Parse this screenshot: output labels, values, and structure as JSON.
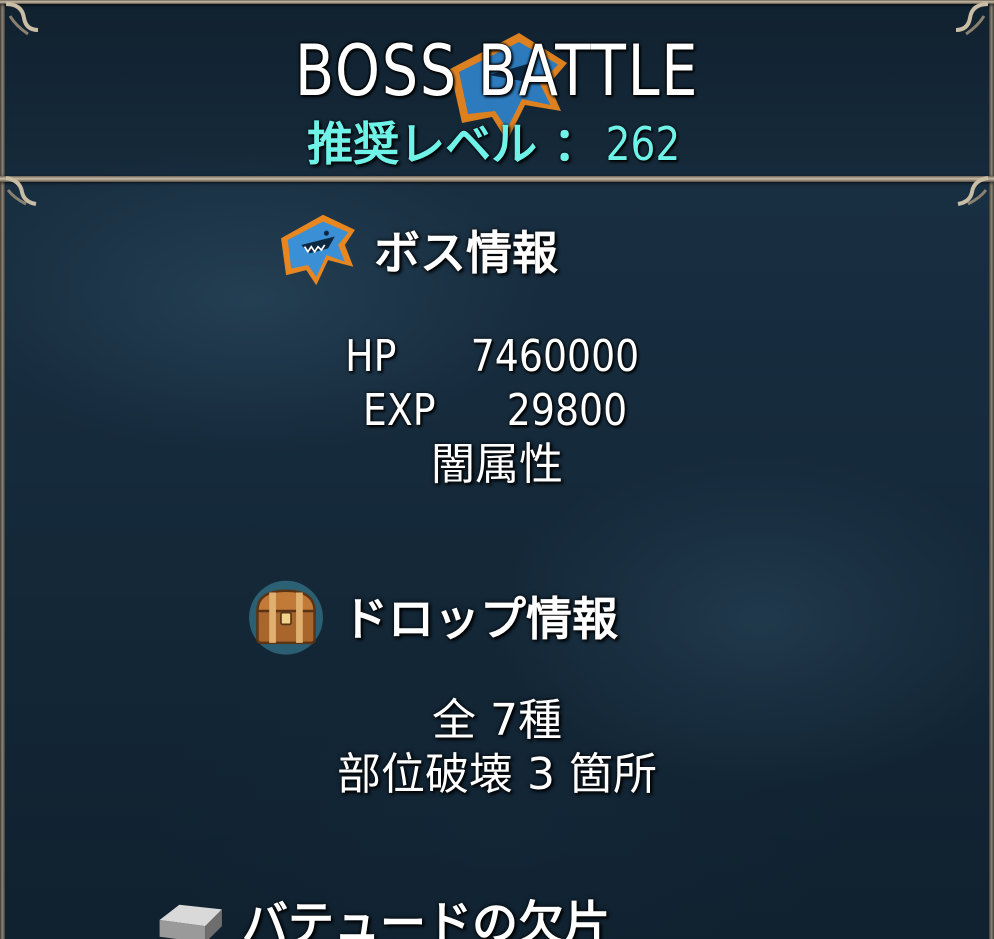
{
  "header": {
    "title": "BOSS  BATTLE",
    "recommended_label": "推奨レベル ：",
    "recommended_value": "262"
  },
  "boss_info": {
    "heading": "ボス情報",
    "icon": "shark-boss-icon",
    "hp_label": "HP",
    "hp_value": "7460000",
    "exp_label": "EXP",
    "exp_value": "29800",
    "attribute": "闇属性"
  },
  "drop_info": {
    "heading": "ドロップ情報",
    "icon": "treasure-chest-icon",
    "total": "全 7種",
    "parts": "部位破壊 3 箇所"
  },
  "item": {
    "name": "バテュードの欠片",
    "icon": "ingot-icon"
  },
  "colors": {
    "accent": "#6ff2e8",
    "text": "#ffffff",
    "background": "#172d3f",
    "frame": "#c9bda6",
    "emblem_orange": "#e8861f",
    "emblem_blue": "#2f7fc4"
  }
}
